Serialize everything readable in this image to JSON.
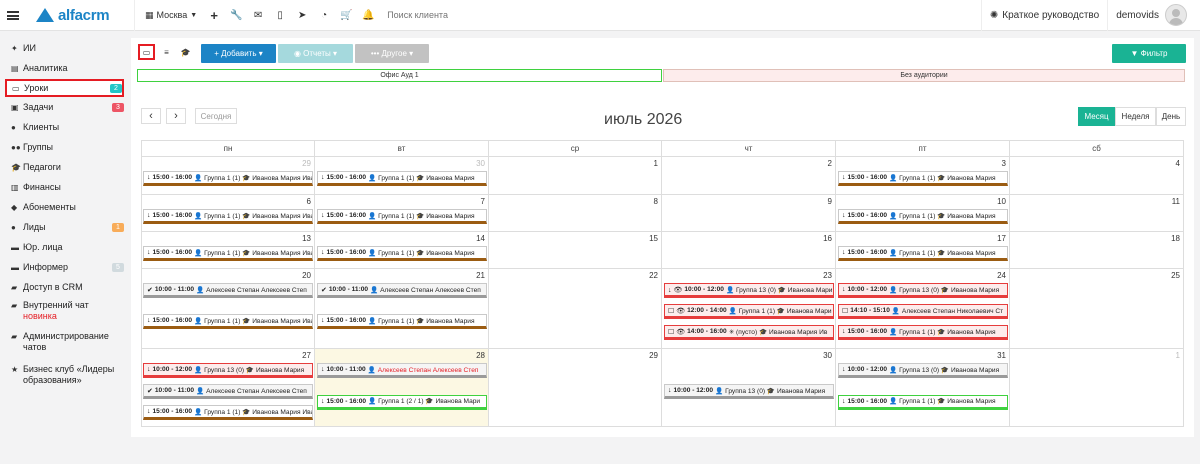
{
  "topbar": {
    "city": "Москва",
    "search_placeholder": "Поиск клиента",
    "guide": "Краткое руководство",
    "username": "demovids",
    "logo_text": "alfacrm"
  },
  "sidebar": {
    "items": [
      {
        "key": "ai",
        "label": "ИИ",
        "icon": "sparkle-icon"
      },
      {
        "key": "analytics",
        "label": "Аналитика",
        "icon": "chart-icon"
      },
      {
        "key": "lessons",
        "label": "Уроки",
        "icon": "calendar-icon",
        "badge": "2",
        "badge_color": "#23c6c8",
        "active": true
      },
      {
        "key": "tasks",
        "label": "Задачи",
        "icon": "tasks-icon",
        "badge": "3",
        "badge_color": "#ed5565"
      },
      {
        "key": "clients",
        "label": "Клиенты",
        "icon": "user-icon"
      },
      {
        "key": "groups",
        "label": "Группы",
        "icon": "group-icon"
      },
      {
        "key": "teachers",
        "label": "Педагоги",
        "icon": "graduation-cap-icon"
      },
      {
        "key": "finance",
        "label": "Финансы",
        "icon": "money-icon"
      },
      {
        "key": "subscriptions",
        "label": "Абонементы",
        "icon": "tag-icon"
      },
      {
        "key": "leads",
        "label": "Лиды",
        "icon": "lead-icon",
        "badge": "1",
        "badge_color": "#f8ac59"
      },
      {
        "key": "legal",
        "label": "Юр. лица",
        "icon": "briefcase-icon"
      },
      {
        "key": "informer",
        "label": "Информер",
        "icon": "message-icon",
        "badge": "5",
        "badge_color": "#d1dade"
      },
      {
        "key": "crm_access",
        "label": "Доступ в CRM",
        "icon": "lock-icon"
      },
      {
        "key": "chat",
        "label": "Внутренний чат",
        "sub": "новинка",
        "icon": "chat-icon"
      },
      {
        "key": "chat_admin",
        "label": "Администрирование чатов",
        "icon": "chat-admin-icon"
      },
      {
        "key": "club",
        "label": "Бизнес клуб «Лидеры образования»",
        "icon": "star-icon"
      }
    ]
  },
  "toolbar": {
    "add": "+ Добавить ▾",
    "reports": "◉ Отчеты ▾",
    "other": "••• Другое ▾",
    "filter": "▼ Фильтр"
  },
  "rooms": [
    "Офис Ауд 1",
    "Без аудитории"
  ],
  "calendar": {
    "title": "июль 2026",
    "today": "Сегодня",
    "views": [
      "Месяц",
      "Неделя",
      "День"
    ],
    "active_view": "Месяц",
    "days_of_week": [
      "пн",
      "вт",
      "ср",
      "чт",
      "пт",
      "сб"
    ],
    "weeks": [
      [
        {
          "d": "29",
          "o": true
        },
        {
          "d": "30",
          "o": true
        },
        {
          "d": "1"
        },
        {
          "d": "2"
        },
        {
          "d": "3"
        },
        {
          "d": "4"
        }
      ],
      [
        {
          "d": "6"
        },
        {
          "d": "7"
        },
        {
          "d": "8"
        },
        {
          "d": "9"
        },
        {
          "d": "10"
        },
        {
          "d": "11"
        }
      ],
      [
        {
          "d": "13"
        },
        {
          "d": "14"
        },
        {
          "d": "15"
        },
        {
          "d": "16"
        },
        {
          "d": "17"
        },
        {
          "d": "18"
        }
      ],
      [
        {
          "d": "20"
        },
        {
          "d": "21"
        },
        {
          "d": "22"
        },
        {
          "d": "23"
        },
        {
          "d": "24"
        },
        {
          "d": "25"
        }
      ],
      [
        {
          "d": "27"
        },
        {
          "d": "28",
          "today": true
        },
        {
          "d": "29"
        },
        {
          "d": "30"
        },
        {
          "d": "31"
        },
        {
          "d": "1",
          "o": true
        }
      ]
    ],
    "events": [
      {
        "w": 0,
        "c": 0,
        "s": 0,
        "style": "brown",
        "icon": "↓",
        "time": "15:00 - 16:00",
        "text": "👤 Группа 1 (1) 🎓 Иванова Мария Ива"
      },
      {
        "w": 0,
        "c": 1,
        "s": 0,
        "style": "brown",
        "icon": "↓",
        "time": "15:00 - 16:00",
        "text": "👤 Группа 1 (1) 🎓 Иванова Мария"
      },
      {
        "w": 0,
        "c": 4,
        "s": 0,
        "style": "brown",
        "icon": "↓",
        "time": "15:00 - 16:00",
        "text": "👤 Группа 1 (1) 🎓 Иванова Мария"
      },
      {
        "w": 1,
        "c": 0,
        "s": 0,
        "style": "brown",
        "icon": "↓",
        "time": "15:00 - 16:00",
        "text": "👤 Группа 1 (1) 🎓 Иванова Мария Ива"
      },
      {
        "w": 1,
        "c": 1,
        "s": 0,
        "style": "brown",
        "icon": "↓",
        "time": "15:00 - 16:00",
        "text": "👤 Группа 1 (1) 🎓 Иванова Мария"
      },
      {
        "w": 1,
        "c": 4,
        "s": 0,
        "style": "brown",
        "icon": "↓",
        "time": "15:00 - 16:00",
        "text": "👤 Группа 1 (1) 🎓 Иванова Мария"
      },
      {
        "w": 2,
        "c": 0,
        "s": 0,
        "style": "brown",
        "icon": "↓",
        "time": "15:00 - 16:00",
        "text": "👤 Группа 1 (1) 🎓 Иванова Мария Ива"
      },
      {
        "w": 2,
        "c": 1,
        "s": 0,
        "style": "brown",
        "icon": "↓",
        "time": "15:00 - 16:00",
        "text": "👤 Группа 1 (1) 🎓 Иванова Мария"
      },
      {
        "w": 2,
        "c": 4,
        "s": 0,
        "style": "brown",
        "icon": "↓",
        "time": "15:00 - 16:00",
        "text": "👤 Группа 1 (1) 🎓 Иванова Мария"
      },
      {
        "w": 3,
        "c": 0,
        "s": 0,
        "style": "gray",
        "icon": "✔",
        "time": "10:00 - 11:00",
        "text": "👤 Алексеев Степан Алексеев Степ"
      },
      {
        "w": 3,
        "c": 0,
        "s": 1,
        "style": "brown",
        "icon": "↓",
        "time": "15:00 - 16:00",
        "text": "👤 Группа 1 (1) 🎓 Иванова Мария Ива"
      },
      {
        "w": 3,
        "c": 1,
        "s": 0,
        "style": "gray",
        "icon": "✔",
        "time": "10:00 - 11:00",
        "text": "👤 Алексеев Степан Алексеев Степ"
      },
      {
        "w": 3,
        "c": 1,
        "s": 1,
        "style": "brown",
        "icon": "↓",
        "time": "15:00 - 16:00",
        "text": "👤 Группа 1 (1) 🎓 Иванова Мария"
      },
      {
        "w": 3,
        "c": 3,
        "s": 0,
        "style": "red",
        "icon": "↓ 👁",
        "time": "10:00 - 12:00",
        "text": "👤 Группа 13 (0) 🎓 Иванова Мари"
      },
      {
        "w": 3,
        "c": 3,
        "s": 1,
        "style": "red",
        "icon": "☐ 👁",
        "time": "12:00 - 14:00",
        "text": "👤 Группа 1 (1) 🎓 Иванова Мари"
      },
      {
        "w": 3,
        "c": 3,
        "s": 2,
        "style": "red",
        "icon": "☐ 👁",
        "time": "14:00 - 16:00",
        "text": "✳ (пусто) 🎓 Иванова Мария Ив"
      },
      {
        "w": 3,
        "c": 4,
        "s": 0,
        "style": "red",
        "icon": "↓",
        "time": "10:00 - 12:00",
        "text": "👤 Группа 13 (0) 🎓 Иванова Мария"
      },
      {
        "w": 3,
        "c": 4,
        "s": 1,
        "style": "red",
        "icon": "☐",
        "time": "14:10 - 15:10",
        "text": "👤 Алексеев Степан Николаевич Ст"
      },
      {
        "w": 3,
        "c": 4,
        "s": 2,
        "style": "red",
        "icon": "↓",
        "time": "15:00 - 16:00",
        "text": "👤 Группа 1 (1) 🎓 Иванова Мария"
      },
      {
        "w": 4,
        "c": 0,
        "s": 0,
        "style": "red",
        "icon": "↓",
        "time": "10:00 - 12:00",
        "text": "👤 Группа 13 (0) 🎓 Иванова Мария"
      },
      {
        "w": 4,
        "c": 0,
        "s": 1,
        "style": "gray",
        "icon": "✔",
        "time": "10:00 - 11:00",
        "text": "👤 Алексеев Степан Алексеев Степ"
      },
      {
        "w": 4,
        "c": 0,
        "s": 2,
        "style": "brown",
        "icon": "↓",
        "time": "15:00 - 16:00",
        "text": "👤 Группа 1 (1) 🎓 Иванова Мария Ива"
      },
      {
        "w": 4,
        "c": 1,
        "s": 0,
        "style": "gray redtxt",
        "icon": "↓",
        "time": "10:00 - 11:00",
        "text": "👤 Алексеев Степан Алексеев Степ"
      },
      {
        "w": 4,
        "c": 1,
        "s": 1.5,
        "style": "green",
        "icon": "↓",
        "time": "15:00 - 16:00",
        "text": "👤 Группа 1 (2 / 1) 🎓 Иванова Мари"
      },
      {
        "w": 4,
        "c": 3,
        "s": 1,
        "style": "gray",
        "icon": "↓",
        "time": "10:00 - 12:00",
        "text": "👤 Группа 13 (0) 🎓 Иванова Мария"
      },
      {
        "w": 4,
        "c": 4,
        "s": 0,
        "style": "gray",
        "icon": "↓",
        "time": "10:00 - 12:00",
        "text": "👤 Группа 13 (0) 🎓 Иванова Мария"
      },
      {
        "w": 4,
        "c": 4,
        "s": 1.5,
        "style": "green",
        "icon": "↓",
        "time": "15:00 - 16:00",
        "text": "👤 Группа 1 (1) 🎓 Иванова Мария"
      }
    ]
  },
  "colors": {
    "brand": "#1c84c6",
    "add": "#1c84c6",
    "reports": "#a5d9dd",
    "other": "#c2c2c2",
    "filter": "#1ab394",
    "active_red": "#e51c23"
  }
}
